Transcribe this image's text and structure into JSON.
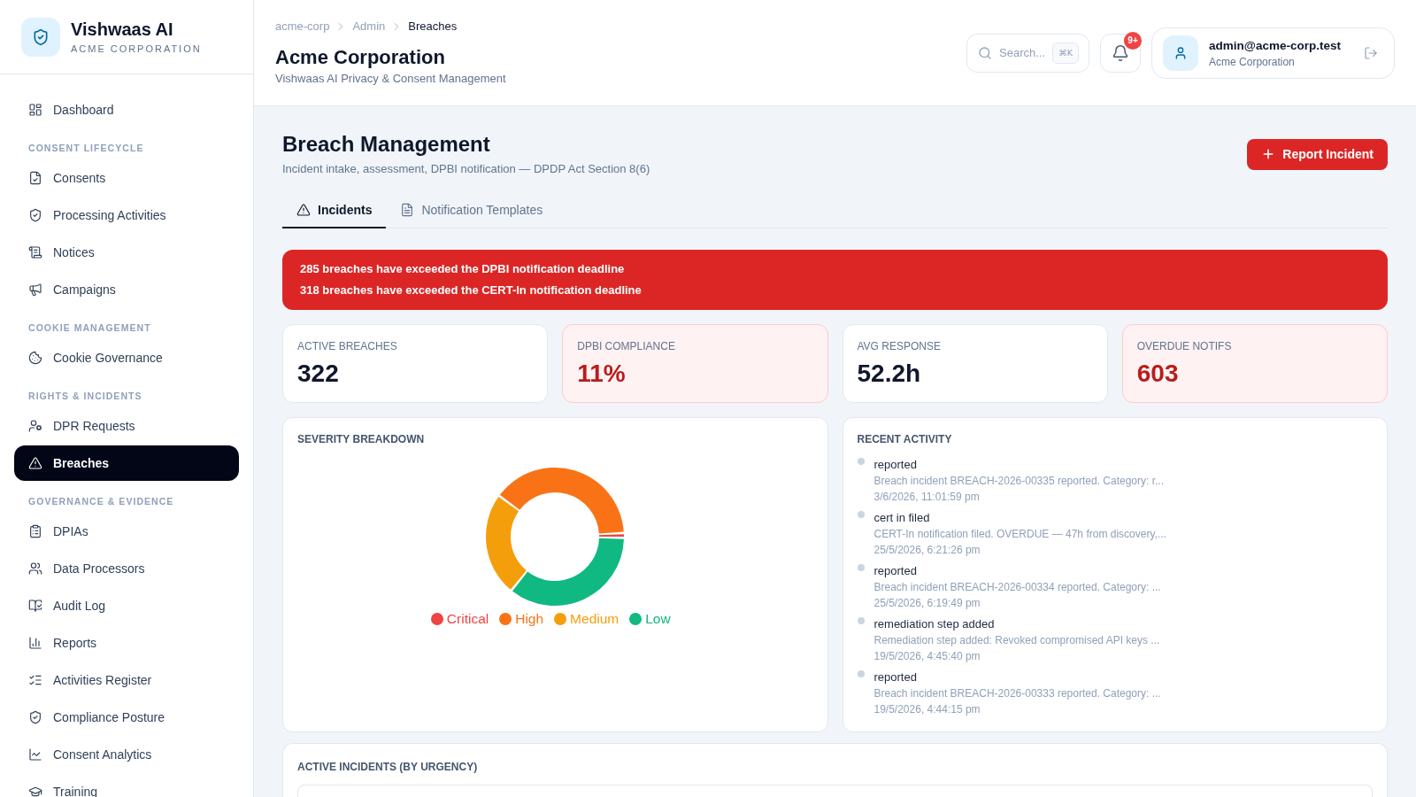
{
  "sidebar": {
    "brand": {
      "name": "Vishwaas AI",
      "org": "ACME CORPORATION"
    },
    "sections": [
      {
        "items": [
          {
            "label": "Dashboard",
            "selected": false
          }
        ]
      },
      {
        "heading": "CONSENT LIFECYCLE",
        "items": [
          {
            "label": "Consents",
            "selected": false
          },
          {
            "label": "Processing Activities",
            "selected": false
          },
          {
            "label": "Notices",
            "selected": false
          },
          {
            "label": "Campaigns",
            "selected": false
          }
        ]
      },
      {
        "heading": "COOKIE MANAGEMENT",
        "items": [
          {
            "label": "Cookie Governance",
            "selected": false
          }
        ]
      },
      {
        "heading": "RIGHTS & INCIDENTS",
        "items": [
          {
            "label": "DPR Requests",
            "selected": false
          },
          {
            "label": "Breaches",
            "selected": true
          }
        ]
      },
      {
        "heading": "GOVERNANCE & EVIDENCE",
        "items": [
          {
            "label": "DPIAs",
            "selected": false
          },
          {
            "label": "Data Processors",
            "selected": false
          },
          {
            "label": "Audit Log",
            "selected": false
          },
          {
            "label": "Reports",
            "selected": false
          },
          {
            "label": "Activities Register",
            "selected": false
          },
          {
            "label": "Compliance Posture",
            "selected": false
          },
          {
            "label": "Consent Analytics",
            "selected": false
          },
          {
            "label": "Training",
            "selected": false
          }
        ]
      }
    ]
  },
  "header": {
    "breadcrumb": [
      "acme-corp",
      "Admin",
      "Breaches"
    ],
    "title": "Acme Corporation",
    "subtitle": "Vishwaas AI Privacy & Consent Management",
    "search": {
      "placeholder": "Search...",
      "shortcut": "⌘K"
    },
    "notifications": {
      "badge": "9+"
    },
    "user": {
      "email": "admin@acme-corp.test",
      "org": "Acme Corporation"
    }
  },
  "page": {
    "title": "Breach Management",
    "subtitle": "Incident intake, assessment, DPBI notification — DPDP Act Section 8(6)",
    "action": "Report Incident"
  },
  "tabs": [
    {
      "label": "Incidents",
      "selected": true
    },
    {
      "label": "Notification Templates",
      "selected": false
    }
  ],
  "alert": {
    "lines": [
      "285 breaches have exceeded the DPBI notification deadline",
      "318 breaches have exceeded the CERT-In notification deadline"
    ]
  },
  "stats": [
    {
      "label": "ACTIVE BREACHES",
      "value": "322",
      "alert": false
    },
    {
      "label": "DPBI COMPLIANCE",
      "value": "11%",
      "alert": true
    },
    {
      "label": "AVG RESPONSE",
      "value": "52.2h",
      "alert": false
    },
    {
      "label": "OVERDUE NOTIFS",
      "value": "603",
      "alert": true
    }
  ],
  "severity": {
    "title": "SEVERITY BREAKDOWN",
    "chart_data": {
      "type": "donut",
      "categories": [
        "Critical",
        "High",
        "Medium",
        "Low"
      ],
      "values": [
        0.6,
        39.4,
        24.2,
        35.8
      ],
      "colors": [
        "#ef4444",
        "#f97316",
        "#f59e0b",
        "#10b981"
      ],
      "legend": "bottom"
    }
  },
  "activity": {
    "title": "RECENT ACTIVITY",
    "items": [
      {
        "action": "reported",
        "detail": "Breach incident BREACH-2026-00335 reported. Category: r...",
        "time": "3/6/2026, 11:01:59 pm"
      },
      {
        "action": "cert in filed",
        "detail": "CERT-In notification filed. OVERDUE — 47h from discovery,...",
        "time": "25/5/2026, 6:21:26 pm"
      },
      {
        "action": "reported",
        "detail": "Breach incident BREACH-2026-00334 reported. Category: ...",
        "time": "25/5/2026, 6:19:49 pm"
      },
      {
        "action": "remediation step added",
        "detail": "Remediation step added: Revoked compromised API keys ...",
        "time": "19/5/2026, 4:45:40 pm"
      },
      {
        "action": "reported",
        "detail": "Breach incident BREACH-2026-00333 reported. Category: ...",
        "time": "19/5/2026, 4:44:15 pm"
      }
    ]
  },
  "incidents": {
    "title": "ACTIVE INCIDENTS (BY URGENCY)"
  }
}
